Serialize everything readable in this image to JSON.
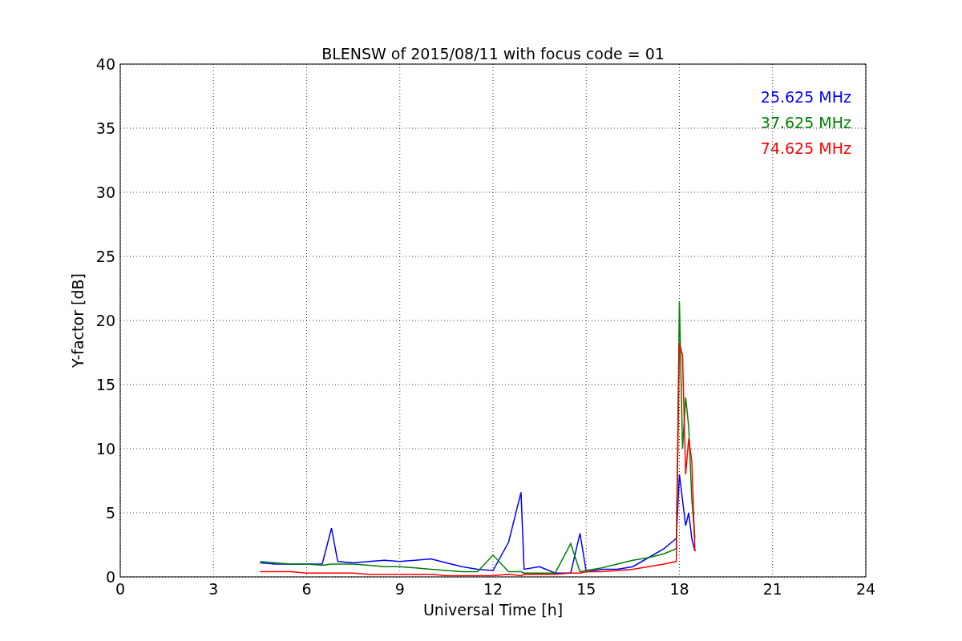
{
  "chart_data": {
    "type": "line",
    "title": "BLENSW of 2015/08/11 with focus code = 01",
    "xlabel": "Universal Time [h]",
    "ylabel": "Y-factor [dB]",
    "x": [
      4.5,
      5,
      5.5,
      6,
      6.5,
      6.8,
      7,
      7.5,
      8,
      8.5,
      9,
      9.5,
      10,
      10.5,
      11,
      11.5,
      12,
      12.5,
      12.9,
      13,
      13.5,
      14,
      14.5,
      14.8,
      15,
      15.5,
      16,
      16.5,
      17,
      17.5,
      17.9,
      18.0,
      18.1,
      18.2,
      18.3,
      18.4,
      18.5
    ],
    "series": [
      {
        "name": "25.625 MHz",
        "color": "#0000ff",
        "values": [
          1.1,
          1.0,
          1.0,
          1.0,
          1.0,
          3.8,
          1.2,
          1.1,
          1.2,
          1.3,
          1.2,
          1.3,
          1.4,
          1.1,
          0.8,
          0.6,
          0.5,
          2.7,
          6.6,
          0.6,
          0.8,
          0.3,
          0.3,
          3.4,
          0.4,
          0.6,
          0.6,
          0.8,
          1.5,
          2.2,
          3.0,
          8.0,
          6.0,
          4.0,
          5.0,
          3.0,
          2.0
        ]
      },
      {
        "name": "37.625 MHz",
        "color": "#008000",
        "values": [
          1.2,
          1.1,
          1.0,
          1.0,
          0.9,
          1.0,
          1.0,
          1.0,
          0.9,
          0.8,
          0.8,
          0.7,
          0.6,
          0.5,
          0.4,
          0.4,
          1.7,
          0.4,
          0.4,
          0.3,
          0.3,
          0.3,
          2.6,
          0.4,
          0.5,
          0.7,
          1.0,
          1.3,
          1.5,
          1.8,
          2.2,
          21.5,
          10,
          14,
          11.7,
          6,
          3
        ]
      },
      {
        "name": "74.625 MHz",
        "color": "#ff0000",
        "values": [
          0.4,
          0.4,
          0.4,
          0.3,
          0.3,
          0.3,
          0.3,
          0.3,
          0.2,
          0.2,
          0.2,
          0.2,
          0.2,
          0.1,
          0.1,
          0.1,
          0.1,
          0.2,
          0.1,
          0.2,
          0.2,
          0.2,
          0.3,
          0.3,
          0.4,
          0.4,
          0.5,
          0.6,
          0.8,
          1.0,
          1.2,
          18.2,
          17.3,
          8,
          10.8,
          9,
          2
        ]
      }
    ],
    "xlim": [
      0,
      24
    ],
    "ylim": [
      0,
      40
    ],
    "xticks": [
      0,
      3,
      6,
      9,
      12,
      15,
      18,
      21,
      24
    ],
    "yticks": [
      0,
      5,
      10,
      15,
      20,
      25,
      30,
      35,
      40
    ],
    "grid": true
  }
}
